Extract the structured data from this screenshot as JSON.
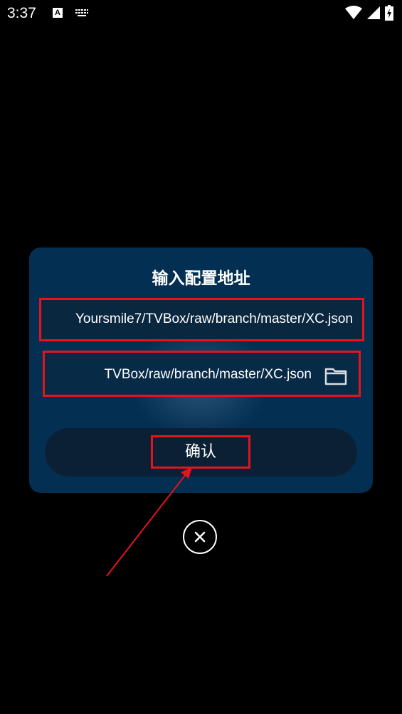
{
  "status_bar": {
    "time": "3:37",
    "a_badge": "A",
    "icons": [
      "text-badge-icon",
      "keyboard-icon",
      "wifi-icon",
      "signal-icon",
      "battery-charging-icon"
    ]
  },
  "dialog": {
    "title": "输入配置地址",
    "url_input_value": "Yoursmile7/TVBox/raw/branch/master/XC.json",
    "local_input_value": "TVBox/raw/branch/master/XC.json",
    "folder_icon": "folder-icon",
    "confirm_label": "确认"
  },
  "close_icon": "close-icon",
  "colors": {
    "dialog_bg": "#032f52",
    "highlight": "#e5131c",
    "confirm_bar_bg": "#0c2035"
  }
}
